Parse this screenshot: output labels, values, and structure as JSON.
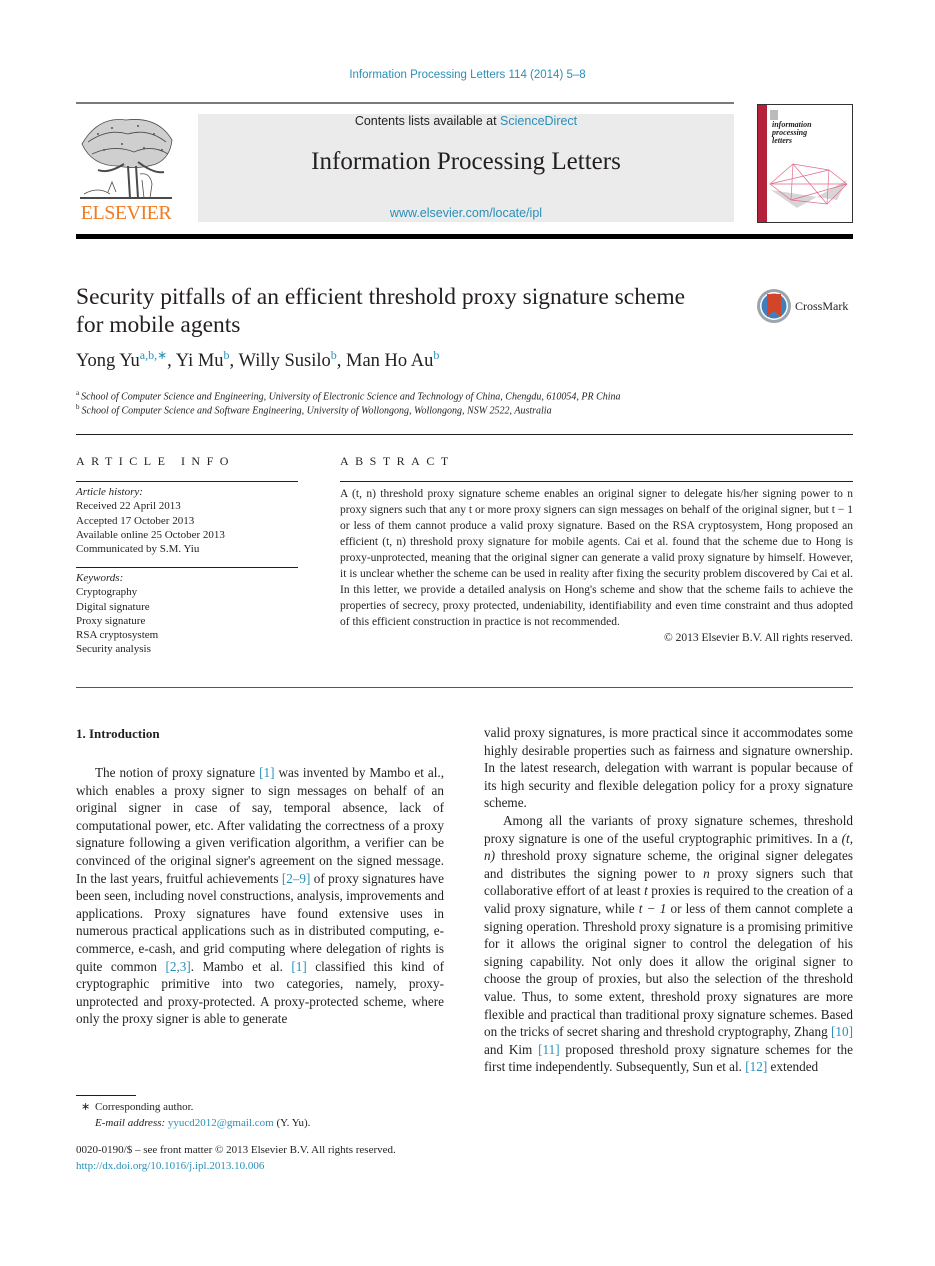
{
  "header": {
    "journal_reference": "Information Processing Letters 114 (2014) 5–8",
    "contents_prefix": "Contents lists available at ",
    "contents_link": "ScienceDirect",
    "journal_title": "Information Processing Letters",
    "journal_url": "www.elsevier.com/locate/ipl",
    "publisher_logo_text": "ELSEVIER",
    "cover_title_lines": [
      "information",
      "processing",
      "letters"
    ],
    "crossmark_label": "CrossMark",
    "colors": {
      "link": "#2a8fb8",
      "elsevier_orange": "#f07b22",
      "cover_red": "#b5213a"
    }
  },
  "article": {
    "title": "Security pitfalls of an efficient threshold proxy signature scheme for mobile agents",
    "authors": [
      {
        "name": "Yong Yu",
        "sup": "a,b,∗",
        "sep": ", "
      },
      {
        "name": "Yi Mu",
        "sup": "b",
        "sep": ", "
      },
      {
        "name": "Willy Susilo",
        "sup": "b",
        "sep": ", "
      },
      {
        "name": "Man Ho Au",
        "sup": "b",
        "sep": ""
      }
    ],
    "affiliations": [
      {
        "mark": "a",
        "text": "School of Computer Science and Engineering, University of Electronic Science and Technology of China, Chengdu, 610054, PR China"
      },
      {
        "mark": "b",
        "text": "School of Computer Science and Software Engineering, University of Wollongong, Wollongong, NSW 2522, Australia"
      }
    ]
  },
  "article_info": {
    "heading": "ARTICLE INFO",
    "history_label": "Article history:",
    "history": [
      "Received 22 April 2013",
      "Accepted 17 October 2013",
      "Available online 25 October 2013",
      "Communicated by S.M. Yiu"
    ],
    "keywords_label": "Keywords:",
    "keywords": [
      "Cryptography",
      "Digital signature",
      "Proxy signature",
      "RSA cryptosystem",
      "Security analysis"
    ]
  },
  "abstract": {
    "heading": "ABSTRACT",
    "text": "A (t, n) threshold proxy signature scheme enables an original signer to delegate his/her signing power to n proxy signers such that any t or more proxy signers can sign messages on behalf of the original signer, but t − 1 or less of them cannot produce a valid proxy signature. Based on the RSA cryptosystem, Hong proposed an efficient (t, n) threshold proxy signature for mobile agents. Cai et al. found that the scheme due to Hong is proxy-unprotected, meaning that the original signer can generate a valid proxy signature by himself. However, it is unclear whether the scheme can be used in reality after fixing the security problem discovered by Cai et al. In this letter, we provide a detailed analysis on Hong's scheme and show that the scheme fails to achieve the properties of secrecy, proxy protected, undeniability, identifiability and even time constraint and thus adopted of this efficient construction in practice is not recommended.",
    "copyright": "© 2013 Elsevier B.V. All rights reserved."
  },
  "body": {
    "section_heading": "1. Introduction",
    "left_paragraphs": [
      [
        {
          "t": "The notion of proxy signature "
        },
        {
          "ref": "[1]"
        },
        {
          "t": " was invented by Mambo et al., which enables a proxy signer to sign mes­sages on behalf of an original signer in case of say, tem­poral absence, lack of computational power, etc. After val­idating the correctness of a proxy signature following a given verification algorithm, a verifier can be convinced of the original signer's agreement on the signed mes­sage. In the last years, fruitful achievements "
        },
        {
          "ref": "[2–9]"
        },
        {
          "t": " of proxy signatures have been seen, including novel constructions, analysis, improvements and applications. Proxy signatures have found extensive uses in numerous practical applica­tions such as in distributed computing, e-commerce, e-cash, and grid computing where delegation of rights is quite common "
        },
        {
          "ref": "[2,3]"
        },
        {
          "t": ". Mambo et al. "
        },
        {
          "ref": "[1]"
        },
        {
          "t": " classified this kind of cryptographic primitive into two categories, namely, proxy-unprotected and proxy-protected. A proxy-protected scheme, where only the proxy signer is able to generate"
        }
      ]
    ],
    "right_paragraphs": [
      [
        {
          "t": "valid proxy signatures, is more practical since it accommo­dates some highly desirable properties such as fairness and signature ownership. In the latest research, delegation with warrant is popular because of its high security and flexible delegation policy for a proxy signature scheme."
        }
      ],
      [
        {
          "t": "Among all the variants of proxy signature schemes, threshold proxy signature is one of the useful crypto­graphic primitives. In a "
        },
        {
          "m": "(t, n)"
        },
        {
          "t": " threshold proxy signature scheme, the original signer delegates and distributes the signing power to "
        },
        {
          "m": "n"
        },
        {
          "t": " proxy signers such that collaborative effort of at least "
        },
        {
          "m": "t"
        },
        {
          "t": " proxies is required to the creation of a valid proxy signature, while "
        },
        {
          "m": "t − 1"
        },
        {
          "t": " or less of them can­not complete a signing operation. Threshold proxy signa­ture is a promising primitive for it allows the original signer to control the delegation of his signing capabil­ity. Not only does it allow the original signer to choose the group of proxies, but also the selection of the thresh­old value. Thus, to some extent, threshold proxy signa­tures are more flexible and practical than traditional proxy signature schemes. Based on the tricks of secret shar­ing and threshold cryptography, Zhang "
        },
        {
          "ref": "[10]"
        },
        {
          "t": " and Kim "
        },
        {
          "ref": "[11]"
        },
        {
          "t": " proposed threshold proxy signature schemes for the first time independently. Subsequently, Sun et al. "
        },
        {
          "ref": "[12]"
        },
        {
          "t": " extended"
        }
      ]
    ]
  },
  "footnote": {
    "star": "∗",
    "corresponding": "Corresponding author.",
    "email_label": "E-mail address:",
    "email": "yyucd2012@gmail.com",
    "email_suffix": " (Y. Yu)."
  },
  "front_matter": {
    "issn_line": "0020-0190/$ – see front matter  © 2013 Elsevier B.V. All rights reserved.",
    "doi": "http://dx.doi.org/10.1016/j.ipl.2013.10.006"
  }
}
